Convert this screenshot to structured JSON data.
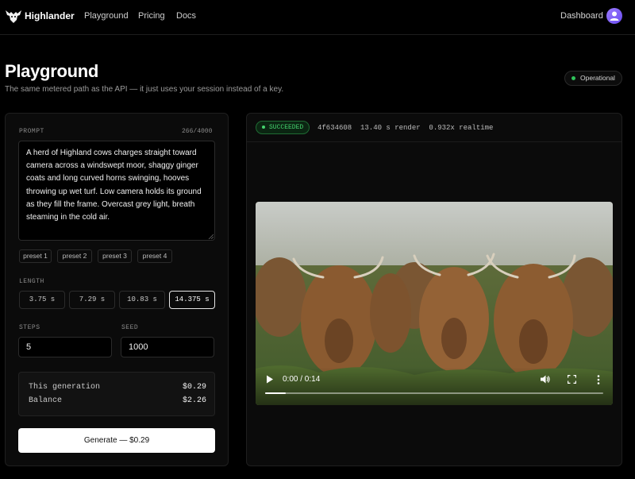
{
  "nav": {
    "brand": "Highlander",
    "links": [
      "Playground",
      "Pricing",
      "Docs"
    ],
    "dashboard": "Dashboard"
  },
  "header": {
    "title": "Playground",
    "subtitle": "The same metered path as the API — it just uses your session instead of a key.",
    "status": "Operational"
  },
  "prompt": {
    "label": "PROMPT",
    "counter": "266/4000",
    "text": "A herd of Highland cows charges straight toward camera across a windswept moor, shaggy ginger coats and long curved horns swinging, hooves throwing up wet turf. Low camera holds its ground as they fill the frame. Overcast grey light, breath steaming in the cold air."
  },
  "presets": [
    "preset 1",
    "preset 2",
    "preset 3",
    "preset 4"
  ],
  "length": {
    "label": "LENGTH",
    "options": [
      "3.75 s",
      "7.29 s",
      "10.83 s",
      "14.375 s"
    ],
    "selected": "14.375 s"
  },
  "steps": {
    "label": "STEPS",
    "value": "5"
  },
  "seed": {
    "label": "SEED",
    "value": "1000"
  },
  "cost": {
    "generation_label": "This generation",
    "generation_value": "$0.29",
    "balance_label": "Balance",
    "balance_value": "$2.26"
  },
  "generate_label": "Generate — $0.29",
  "result": {
    "status": "SUCCEEDED",
    "meta": "4f634608  13.40 s render  0.932x realtime",
    "video_time": "0:00 / 0:14",
    "progress": 0.06
  },
  "colors": {
    "accent_ok": "#45d36e",
    "status_dot": "#2fc35a",
    "avatar": "#7b5cf5"
  }
}
